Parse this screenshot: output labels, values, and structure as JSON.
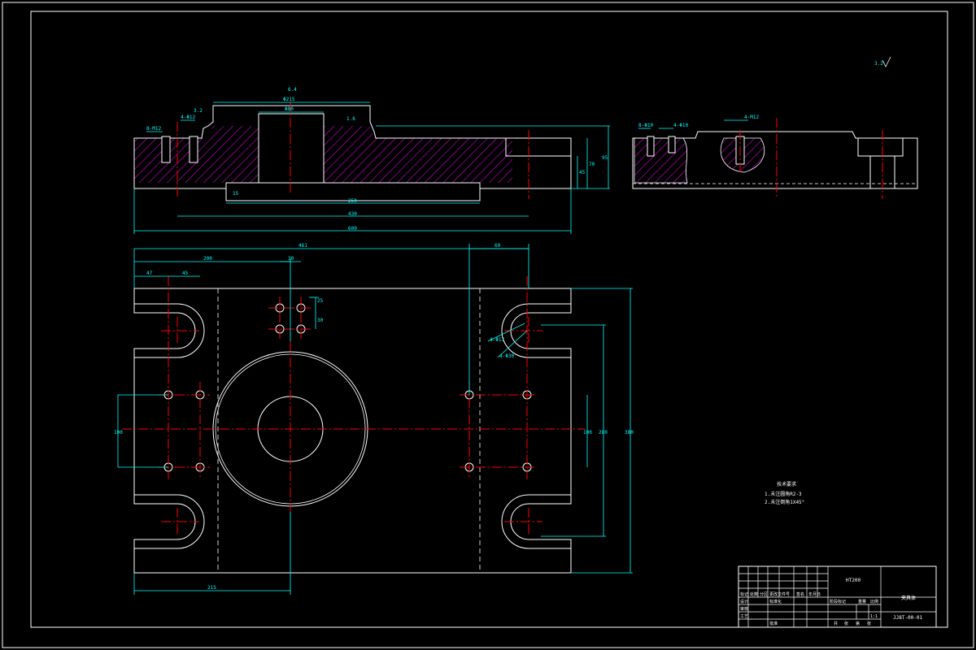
{
  "drawing": {
    "colors": {
      "background": "#000000",
      "outline": "#ffffff",
      "dimension": "#00ffff",
      "centerline": "#ff0000",
      "hatch": "#ff00ff"
    },
    "top_view_dims": {
      "phi_top": "Φ215",
      "phi_hole": "Φ80",
      "len_250": "250",
      "len_430": "430",
      "len_600": "600",
      "h_95": "95",
      "h_70": "70",
      "h_45": "45",
      "h_15": "15",
      "tap_left": "8-M12",
      "tap_left2": "4-Φ12",
      "roughness_top": "6.4",
      "roughness_a": "3.2",
      "roughness_b": "1.6"
    },
    "side_view_dims": {
      "tap_a": "8-Φ10",
      "tap_b": "4-Φ10",
      "tap_c": "4-M12"
    },
    "plan_view_dims": {
      "w_461": "461",
      "w_60": "60",
      "w_200": "200",
      "w_30": "30",
      "w_47": "47",
      "w_45": "45",
      "h_25": "25",
      "h_30": "30",
      "h_100": "100",
      "h_100b": "100",
      "h_280": "280",
      "h_380": "380",
      "w_215": "215",
      "hole_a": "4-Φ17",
      "hole_b": "4-Φ30"
    },
    "roughness_global": "3.2",
    "tech_req": {
      "title": "技术要求",
      "item1": "1.未注圆角R2-3",
      "item2": "2.未注倒角1X45°"
    },
    "title_block": {
      "material": "HT200",
      "part_name": "夹具体",
      "drawing_no": "JJ8T-00-01",
      "scale": "1:1",
      "labels": [
        "标记",
        "处数",
        "分区",
        "更改文件号",
        "签名",
        "年月日",
        "设计",
        "标准化",
        "阶段标记",
        "重量",
        "比例",
        "审核",
        "工艺",
        "批准",
        "共",
        "张",
        "第",
        "张"
      ]
    }
  }
}
